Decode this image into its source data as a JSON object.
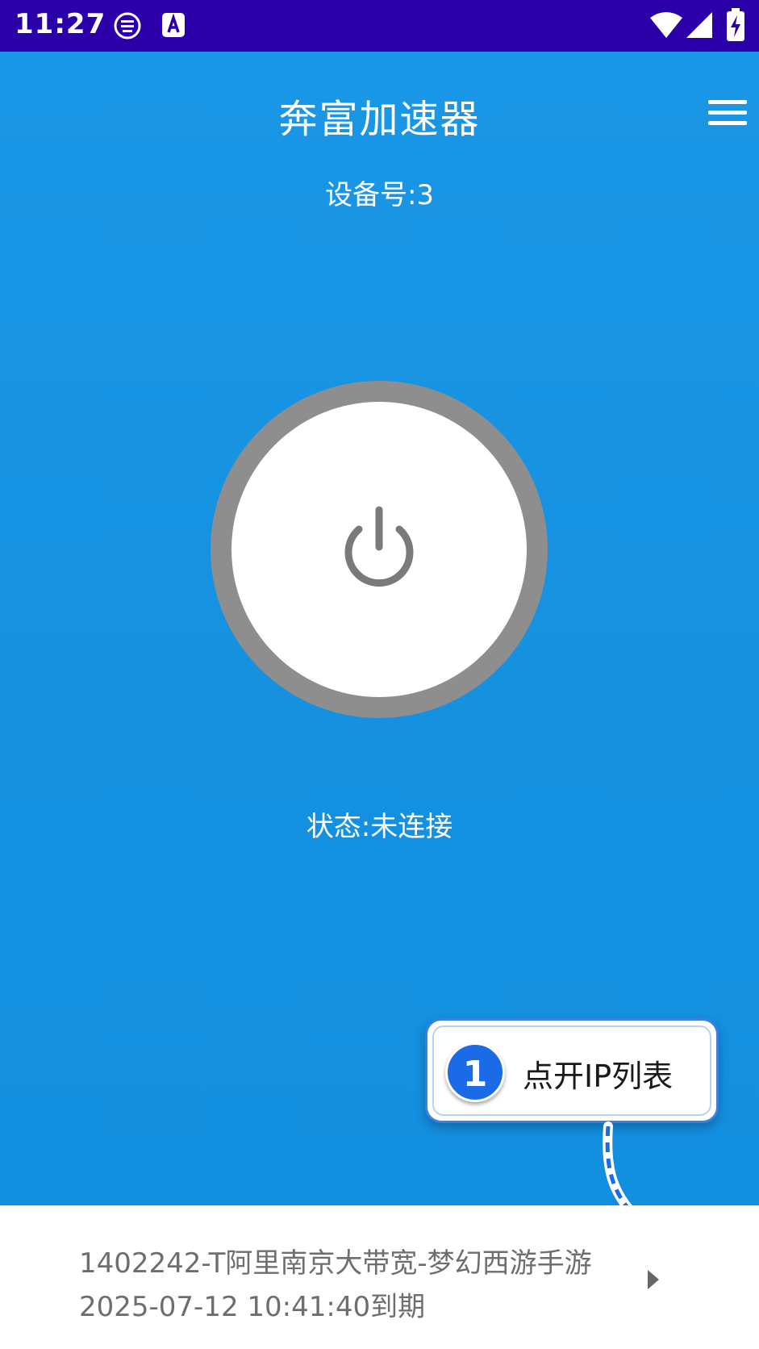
{
  "status_bar": {
    "time": "11:27",
    "left_icons": [
      "notification-app-icon",
      "notification-a-icon"
    ],
    "right_icons": [
      "wifi-icon",
      "cellular-signal-icon",
      "battery-charging-icon"
    ],
    "background_color": "#2b00a8"
  },
  "header": {
    "title": "奔富加速器",
    "menu_icon": "hamburger-menu-icon"
  },
  "device": {
    "label": "设备号:3"
  },
  "power_button": {
    "icon": "power-icon",
    "ring_color": "#8e8e8e",
    "face_color": "#ffffff"
  },
  "connection": {
    "status": "状态:未连接"
  },
  "callout": {
    "step": "1",
    "text": "点开IP列表",
    "accent_color": "#1b6be6"
  },
  "server": {
    "line1": "1402242-T阿里南京大带宽-梦幻西游手游",
    "line2": "2025-07-12 10:41:40到期",
    "arrow_icon": "caret-right-icon"
  },
  "colors": {
    "primary_blue": "#1591e0",
    "text_white": "#ffffff",
    "server_text": "#6e6e6e"
  }
}
